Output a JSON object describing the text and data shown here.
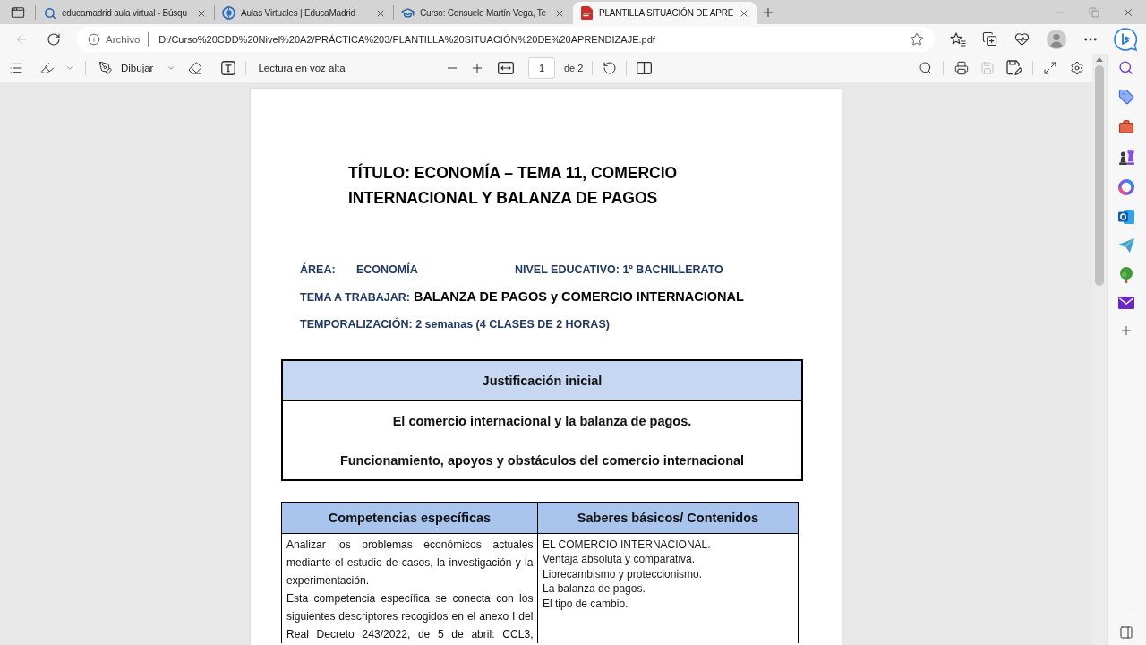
{
  "browser": {
    "tabs": [
      {
        "kind": "search",
        "title": "educamadrid aula virtual - Búsqu",
        "selected": false
      },
      {
        "kind": "globe",
        "title": "Aulas Virtuales | EducaMadrid",
        "selected": false
      },
      {
        "kind": "course",
        "title": "Curso: Consuelo Martín Vega, Te",
        "selected": false
      },
      {
        "kind": "pdf",
        "title": "PLANTILLA SITUACIÓN DE APRE",
        "selected": true
      }
    ],
    "back_disabled": true,
    "address_bar": {
      "site_label": "Archivo",
      "url": "D:/Curso%20CDD%20Nivel%20A2/PRÁCTICA%203/PLANTILLA%20SITUACIÓN%20DE%20APRENDIZAJE.pdf"
    }
  },
  "pdf_toolbar": {
    "draw_label": "Dibujar",
    "read_aloud_label": "Lectura en voz alta",
    "page": "1",
    "page_count": "de 2",
    "save_disabled": true
  },
  "document": {
    "title": "TÍTULO: ECONOMÍA – TEMA 11, COMERCIO INTERNACIONAL Y BALANZA DE PAGOS",
    "area": {
      "label": "ÁREA:",
      "value": "ECONOMÍA"
    },
    "nivel_educativo": "NIVEL EDUCATIVO: 1º BACHILLERATO",
    "tema": {
      "label": "TEMA A TRABAJAR:",
      "value": "BALANZA DE PAGOS y COMERCIO INTERNACIONAL"
    },
    "temporalizacion": "TEMPORALIZACIÓN: 2 semanas (4 CLASES DE 2 HORAS)",
    "justificacion": {
      "heading": "Justificación inicial",
      "lines": [
        "El comercio internacional y la balanza de pagos.",
        "Funcionamiento, apoyos y obstáculos del comercio internacional"
      ]
    },
    "table": {
      "columns": [
        "Competencias específicas",
        "Saberes básicos/ Contenidos"
      ],
      "rows": [
        {
          "competencias": [
            "Analizar los problemas económicos actuales mediante el estudio de casos, la investigación y la experimentación.",
            "Esta competencia específica se conecta con los siguientes descriptores recogidos en el anexo I del Real Decreto 243/2022, de 5 de abril: CCL3,"
          ],
          "saberes": [
            "EL COMERCIO INTERNACIONAL.",
            "Ventaja absoluta y comparativa.",
            "Librecambismo y proteccionismo.",
            "La balanza de pagos.",
            "El tipo de cambio."
          ]
        }
      ]
    }
  }
}
